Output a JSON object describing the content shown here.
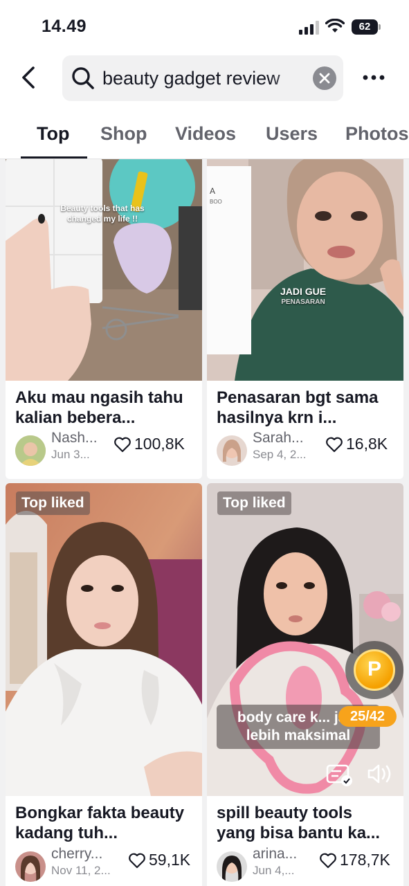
{
  "status_bar": {
    "time": "14.49",
    "battery": "62"
  },
  "search": {
    "query": "beauty gadget review"
  },
  "tabs": [
    {
      "label": "Top",
      "active": true
    },
    {
      "label": "Shop"
    },
    {
      "label": "Videos"
    },
    {
      "label": "Users"
    },
    {
      "label": "Photos"
    }
  ],
  "cards": [
    {
      "overlay_text": "Beauty tools that has changed my life !!",
      "title": "Aku mau ngasih tahu kalian bebera...",
      "author": "Nash...",
      "date": "Jun 3...",
      "likes": "100,8K"
    },
    {
      "overlay_text": "JADI GUE",
      "overlay_subtext": "PENASARAN",
      "title": " Penasaran bgt sama hasilnya krn i...",
      "author": "Sarah...",
      "date": "Sep 4, 2...",
      "likes": "16,8K"
    },
    {
      "badge": "Top liked",
      "title": "Bongkar fakta beauty kadang tuh...",
      "author": "cherry...",
      "date": "Nov 11, 2...",
      "likes": "59,1K"
    },
    {
      "badge": "Top liked",
      "caption": "body care k... jadi lebih maksimal",
      "coin_letter": "P",
      "counter": "25/42",
      "title": "spill beauty tools yang bisa bantu ka...",
      "author": "arina...",
      "date": "Jun 4,...",
      "likes": "178,7K"
    }
  ],
  "colors": {
    "text": "#161823",
    "secondary": "#62636b",
    "background": "#f1f1f2",
    "coin": "#f7a31b"
  }
}
